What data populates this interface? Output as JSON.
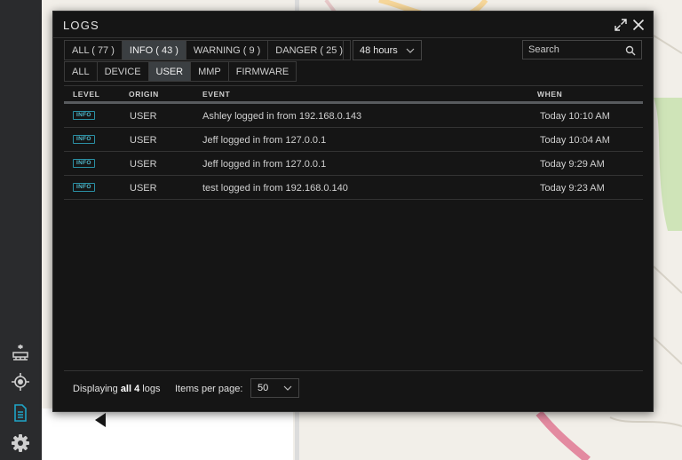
{
  "sidebar": {
    "items": [
      {
        "icon": "network-topology-icon"
      },
      {
        "icon": "map-locate-icon"
      },
      {
        "icon": "document-logs-icon",
        "active": true
      },
      {
        "icon": "gear-icon"
      }
    ],
    "accent_color": "#1fa5c7"
  },
  "dialog": {
    "title": "LOGS",
    "level_tabs": [
      {
        "label": "ALL ( 77 )",
        "active": false
      },
      {
        "label": "INFO ( 43 )",
        "active": true
      },
      {
        "label": "WARNING ( 9 )",
        "active": false
      },
      {
        "label": "DANGER ( 25 )",
        "active": false
      }
    ],
    "time_range": {
      "value": "48 hours"
    },
    "search": {
      "placeholder": "Search"
    },
    "origin_tabs": [
      {
        "label": "ALL",
        "active": false
      },
      {
        "label": "DEVICE",
        "active": false
      },
      {
        "label": "USER",
        "active": true
      },
      {
        "label": "MMP",
        "active": false
      },
      {
        "label": "FIRMWARE",
        "active": false
      }
    ]
  },
  "table": {
    "columns": {
      "level": "LEVEL",
      "origin": "ORIGIN",
      "event": "EVENT",
      "when": "WHEN"
    },
    "rows": [
      {
        "level": "INFO",
        "origin": "USER",
        "event": "Ashley logged in from 192.168.0.143",
        "when": "Today 10:10 AM"
      },
      {
        "level": "INFO",
        "origin": "USER",
        "event": "Jeff logged in from 127.0.0.1",
        "when": "Today 10:04 AM"
      },
      {
        "level": "INFO",
        "origin": "USER",
        "event": "Jeff logged in from 127.0.0.1",
        "when": "Today 9:29 AM"
      },
      {
        "level": "INFO",
        "origin": "USER",
        "event": "test logged in from 192.168.0.140",
        "when": "Today 9:23 AM"
      }
    ]
  },
  "footer": {
    "displaying_prefix": "Displaying",
    "displaying_bold": "all 4",
    "displaying_suffix": "logs",
    "items_per_page_label": "Items per page:",
    "items_per_page_value": "50"
  },
  "colors": {
    "info_badge": "#4fb8cc"
  }
}
